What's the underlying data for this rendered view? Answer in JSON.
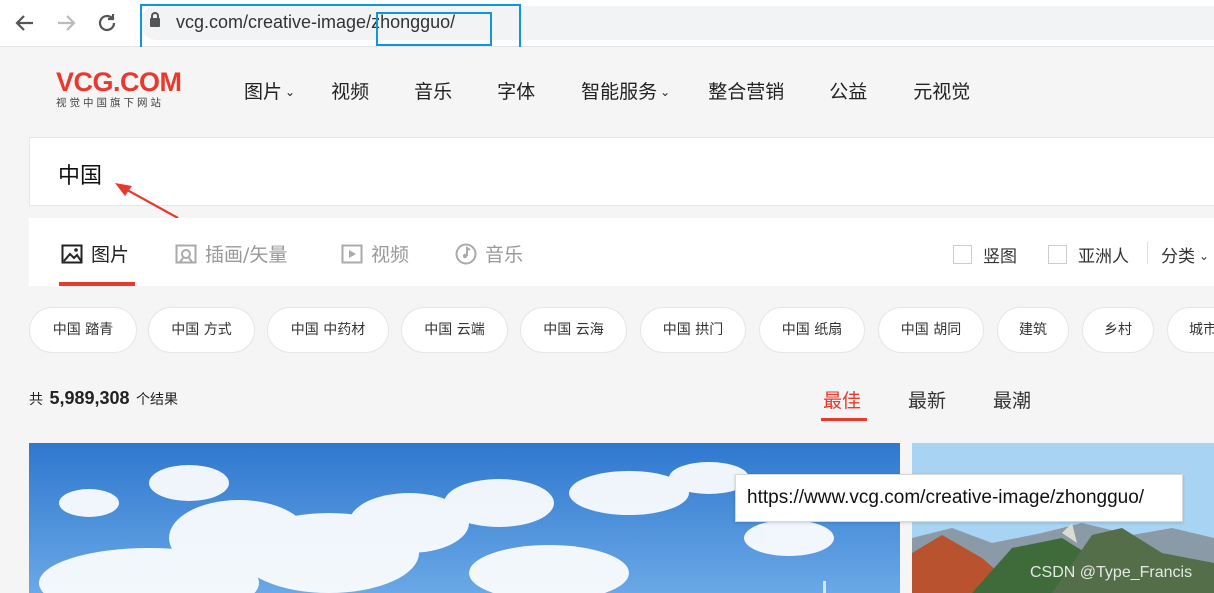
{
  "browser": {
    "back_icon": "arrow-left-icon",
    "forward_icon": "arrow-right-icon",
    "reload_icon": "reload-icon",
    "url_text": "vcg.com/creative-image/zhongguo/"
  },
  "site": {
    "logo_main": "VCG.COM",
    "logo_sub": "视觉中国旗下网站",
    "nav": [
      {
        "label": "图片",
        "dropdown": true
      },
      {
        "label": "视频"
      },
      {
        "label": "音乐"
      },
      {
        "label": "字体"
      },
      {
        "label": "智能服务",
        "dropdown": true
      },
      {
        "label": "整合营销"
      },
      {
        "label": "公益"
      },
      {
        "label": "元视觉"
      }
    ],
    "caret": "⌄"
  },
  "search": {
    "value": "中国"
  },
  "media_tabs": [
    {
      "label": "图片",
      "icon": "image-icon",
      "active": true
    },
    {
      "label": "插画/矢量",
      "icon": "illustration-icon"
    },
    {
      "label": "视频",
      "icon": "video-icon"
    },
    {
      "label": "音乐",
      "icon": "music-icon"
    }
  ],
  "filters": {
    "vertical_label": "竖图",
    "asian_label": "亚洲人",
    "category_label": "分类",
    "category_caret": "⌄"
  },
  "tags": [
    "中国 踏青",
    "中国 方式",
    "中国 中药材",
    "中国 云端",
    "中国 云海",
    "中国 拱门",
    "中国 纸扇",
    "中国 胡同",
    "建筑",
    "乡村",
    "城市"
  ],
  "results": {
    "prefix": "共",
    "count": "5,989,308",
    "suffix": "个结果",
    "sort": [
      "最佳",
      "最新",
      "最潮"
    ]
  },
  "tooltip": "https://www.vcg.com/creative-image/zhongguo/",
  "watermark": "CSDN @Type_Francis",
  "colors": {
    "brand_red": "#e8392e",
    "annotation_blue": "#1296db",
    "annotation_arrow": "#e8392e"
  }
}
